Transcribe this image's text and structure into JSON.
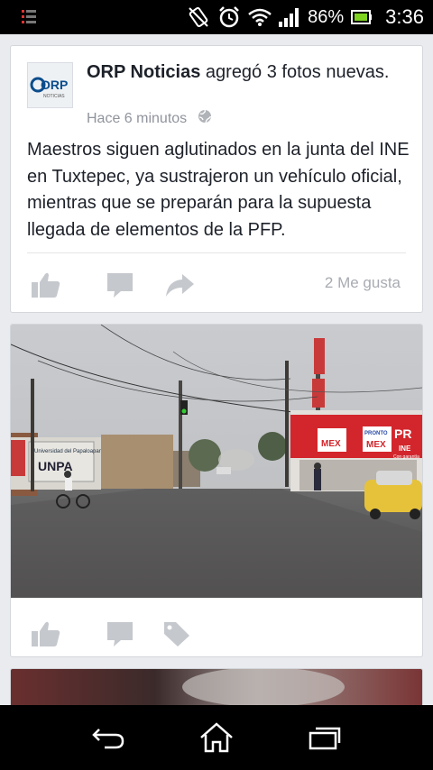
{
  "status_bar": {
    "battery_percent": "86%",
    "time": "3:36",
    "icons": [
      "notification-icon",
      "vibrate-icon",
      "alarm-icon",
      "wifi-icon",
      "signal-icon",
      "battery-icon"
    ]
  },
  "posts": [
    {
      "page_name": "ORP Noticias",
      "action": "agregó 3 fotos nuevas.",
      "time_ago": "Hace 6 minutos",
      "privacy_icon": "globe-icon",
      "avatar_text": "ORP",
      "avatar_sub": "NOTICIAS",
      "text": "Maestros siguen aglutinados en la junta del INE en Tuxtepec, ya sustrajeron un vehículo oficial, mientras que se preparán para la supuesta llegada de elementos de la PFP.",
      "likes": "2 Me gusta",
      "action_icons": [
        "like-icon",
        "comment-icon",
        "share-icon"
      ]
    },
    {
      "photo_signs": {
        "left_sign": "Universidad del Papaloapan",
        "left_sign2": "UNPA",
        "store_logo": "MEX",
        "store_brand": "PRONTO",
        "store_brand2": "MEX",
        "store_right": "PR",
        "store_right2": "INE",
        "store_small": "Con garantía"
      },
      "action_icons": [
        "like-icon",
        "comment-icon",
        "tag-icon"
      ]
    }
  ],
  "colors": {
    "background": "#e9ebee",
    "text": "#1d2129",
    "meta": "#90949c",
    "icon_gray": "#c5c8cd"
  },
  "nav_bar": {
    "icons": [
      "back-icon",
      "home-icon",
      "recents-icon"
    ]
  }
}
